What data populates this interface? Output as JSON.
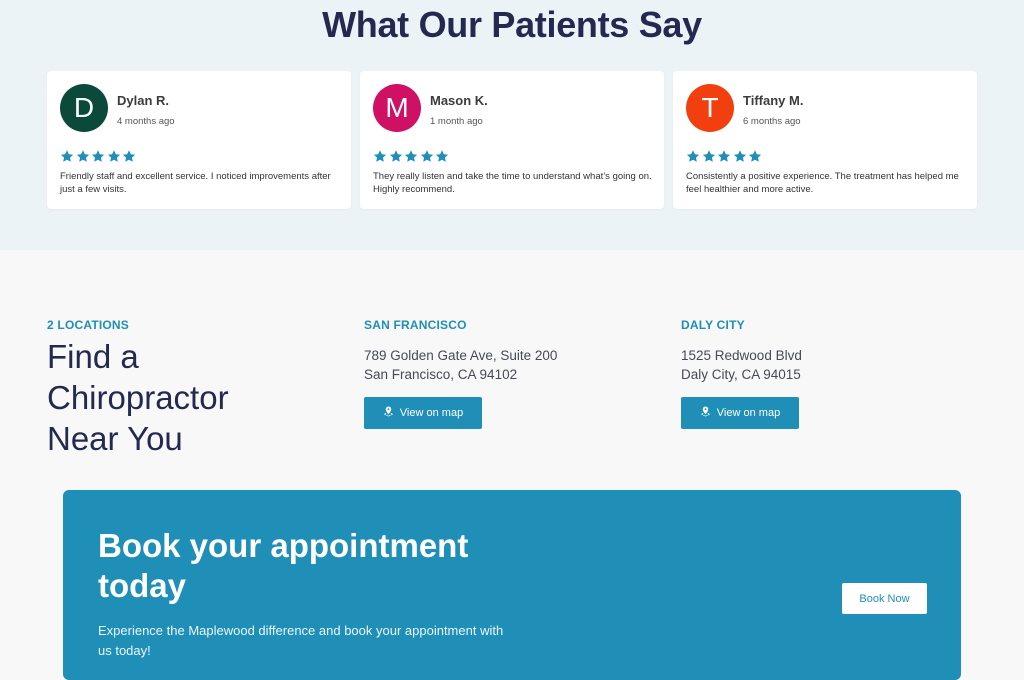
{
  "testimonials": {
    "title": "What Our Patients Say",
    "star_color": "#1f8fb8",
    "reviews": [
      {
        "initial": "D",
        "avatar_color": "#0b4a3a",
        "name": "Dylan R.",
        "time": "4 months ago",
        "rating": 5,
        "text": "Friendly staff and excellent service. I noticed improvements after just a few visits."
      },
      {
        "initial": "M",
        "avatar_color": "#cf1166",
        "name": "Mason K.",
        "time": "1 month ago",
        "rating": 5,
        "text": "They really listen and take the time to understand what’s going on. Highly recommend."
      },
      {
        "initial": "T",
        "avatar_color": "#f23f10",
        "name": "Tiffany M.",
        "time": "6 months ago",
        "rating": 5,
        "text": "Consistently a positive experience. The treatment has helped me feel healthier and more active."
      }
    ]
  },
  "locations": {
    "eyebrow": "2 LOCATIONS",
    "title": "Find a Chiropractor Near You",
    "items": [
      {
        "city": "SAN FRANCISCO",
        "line1": "789 Golden Gate Ave, Suite 200",
        "line2": "San Francisco, CA 94102",
        "button": "View on map"
      },
      {
        "city": "DALY CITY",
        "line1": "1525 Redwood Blvd",
        "line2": "Daly City, CA 94015",
        "button": "View on map"
      }
    ]
  },
  "cta": {
    "title": "Book your appointment today",
    "subtitle": "Experience the Maplewood difference and book your appointment with us today!",
    "button": "Book Now",
    "background_color": "#1f8fb8"
  }
}
